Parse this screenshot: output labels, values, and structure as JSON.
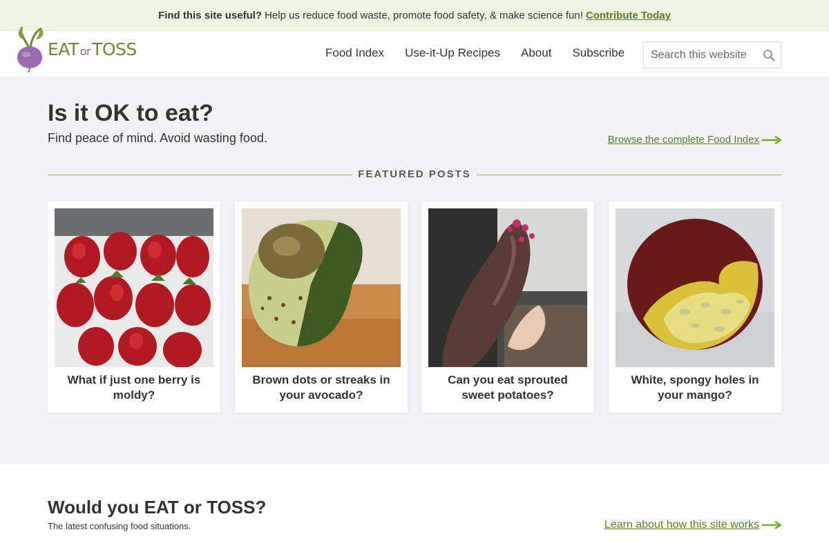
{
  "promo": {
    "lead": "Find this site useful?",
    "text": "Help us reduce food waste, promote food safety, & make science fun!",
    "link": "Contribute Today"
  },
  "header": {
    "logo": {
      "eat": "EAT",
      "or": "or",
      "toss": "TOSS"
    },
    "nav": [
      "Food Index",
      "Use-it-Up Recipes",
      "About",
      "Subscribe"
    ],
    "search_placeholder": "Search this website"
  },
  "hero": {
    "title": "Is it OK to eat?",
    "subtitle": "Find peace of mind. Avoid wasting food.",
    "browse_link": "Browse the complete Food Index"
  },
  "featured": {
    "label": "FEATURED POSTS",
    "posts": [
      {
        "title": "What if just one berry is moldy?"
      },
      {
        "title": "Brown dots or streaks in your avocado?"
      },
      {
        "title": "Can you eat sprouted sweet potatoes?"
      },
      {
        "title": "White, spongy holes in your mango?"
      }
    ]
  },
  "section2": {
    "title": "Would you EAT or TOSS?",
    "subtitle": "The latest confusing food situations.",
    "link": "Learn about how this site works"
  },
  "colors": {
    "accent": "#5a7d22",
    "promo_bg": "#eef4e2",
    "page_bg": "#f3f3f6"
  }
}
